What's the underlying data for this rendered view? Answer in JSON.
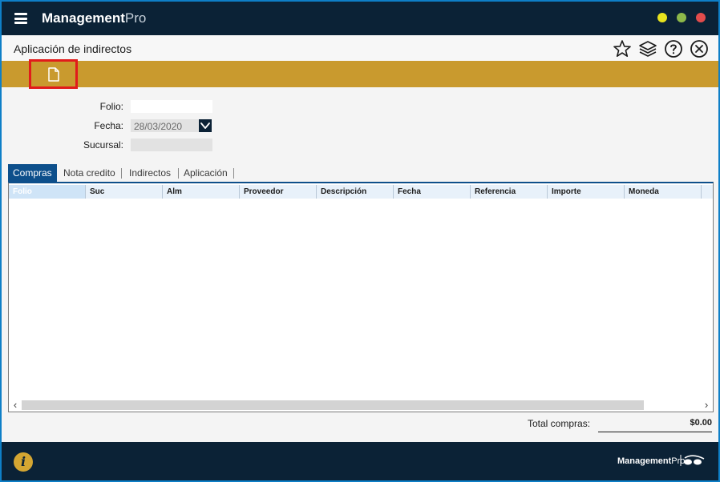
{
  "app": {
    "title_bold": "Management",
    "title_light": "Pro",
    "colors": {
      "titlebar": "#0b2236",
      "toolbar": "#c99a2e",
      "accent": "#0d4f8b"
    }
  },
  "header": {
    "title": "Aplicación de indirectos",
    "icons": [
      "star-icon",
      "layers-icon",
      "help-icon",
      "close-icon"
    ]
  },
  "toolbar": {
    "icons": [
      "new-document-icon"
    ]
  },
  "form": {
    "folio_label": "Folio:",
    "folio_value": "",
    "fecha_label": "Fecha:",
    "fecha_value": "28/03/2020",
    "sucursal_label": "Sucursal:",
    "sucursal_value": ""
  },
  "tabs": [
    {
      "label": "Compras"
    },
    {
      "label": "Nota credito"
    },
    {
      "label": "Indirectos"
    },
    {
      "label": "Aplicación"
    }
  ],
  "grid": {
    "columns": [
      "Folio",
      "Suc",
      "Alm",
      "Proveedor",
      "Descripción",
      "Fecha",
      "Referencia",
      "Importe",
      "Moneda"
    ],
    "rows": []
  },
  "totals": {
    "label": "Total compras:",
    "value": "$0.00"
  },
  "footer": {
    "brand_bold": "Management",
    "brand_light": "Pro"
  }
}
